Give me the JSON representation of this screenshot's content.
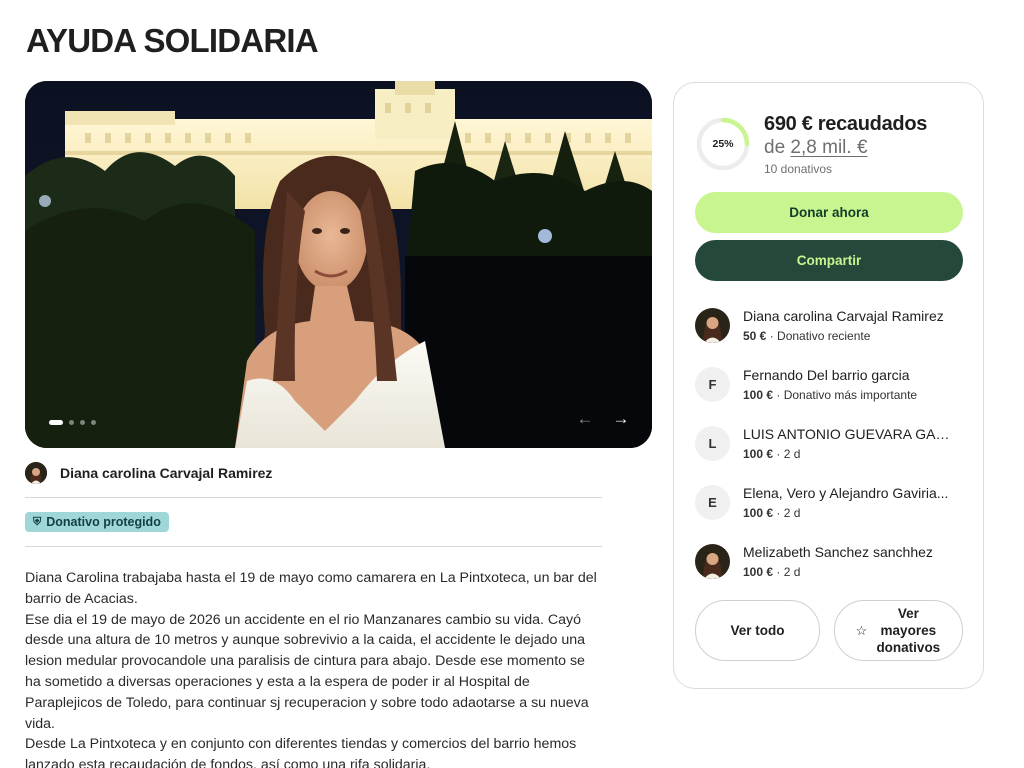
{
  "page": {
    "title": "AYUDA SOLIDARIA"
  },
  "hero": {
    "slide_count": 4,
    "active_slide": 1,
    "prev_icon": "arrow-left-icon",
    "next_icon": "arrow-right-icon"
  },
  "organizer": {
    "name": "Diana carolina Carvajal Ramirez"
  },
  "badge": {
    "label": "Donativo protegido",
    "icon": "shield-icon"
  },
  "description": {
    "paragraphs": [
      "Diana Carolina trabajaba hasta el 19 de mayo como camarera en La Pintxoteca, un bar del barrio de Acacias.",
      "Ese dia el 19 de mayo de 2026 un accidente en el rio Manzanares cambio su vida. Cayó desde una altura de 10 metros y aunque sobrevivio a la caida, el accidente le dejado una lesion medular provocandole una paralisis de cintura para abajo. Desde ese momento se ha sometido a diversas operaciones y esta a la espera de poder ir al Hospital de Paraplejicos de Toledo, para continuar sj recuperacion y sobre todo adaotarse a su nueva vida.",
      "Desde La Pintxoteca y en conjunto con diferentes tiendas y comercios del barrio hemos lanzado esta recaudación de fondos, así como una rifa solidaria."
    ]
  },
  "summary": {
    "progress_percent": 25,
    "progress_label": "25%",
    "raised": "690 € recaudados",
    "goal_prefix": "de",
    "goal_amount": "2,8 mil. €",
    "donations_count": "10 donativos",
    "accent_color": "#c8f58f",
    "dark_color": "#24493b"
  },
  "actions": {
    "donate": "Donar ahora",
    "share": "Compartir",
    "see_all": "Ver todo",
    "top_donations": "Ver mayores donativos",
    "top_icon": "star-icon"
  },
  "donors": [
    {
      "name": "Diana carolina Carvajal Ramirez",
      "amount": "50 €",
      "note": " · Donativo reciente",
      "initial": "",
      "photo": true
    },
    {
      "name": "Fernando Del barrio garcia",
      "amount": "100 €",
      "note": " · Donativo más importante",
      "initial": "F",
      "photo": false
    },
    {
      "name": "LUIS ANTONIO GUEVARA GARCIA",
      "amount": "100 €",
      "note": " · 2 d",
      "initial": "L",
      "photo": false
    },
    {
      "name": "Elena, Vero y Alejandro Gaviria...",
      "amount": "100 €",
      "note": " · 2 d",
      "initial": "E",
      "photo": false
    },
    {
      "name": "Melizabeth Sanchez sanchhez",
      "amount": "100 €",
      "note": " · 2 d",
      "initial": "",
      "photo": true
    }
  ]
}
